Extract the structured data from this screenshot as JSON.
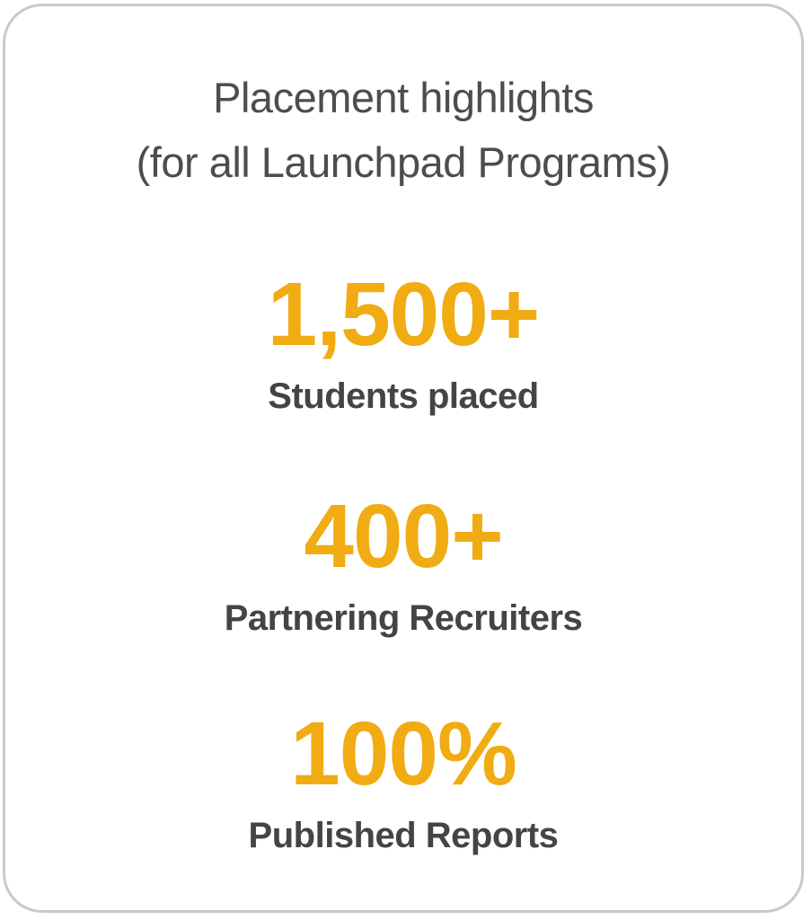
{
  "card": {
    "title_line_1": "Placement highlights",
    "title_line_2": "(for all Launchpad Programs)"
  },
  "stats": [
    {
      "value": "1,500+",
      "label": "Students placed"
    },
    {
      "value": "400+",
      "label": "Partnering Recruiters"
    },
    {
      "value": "100%",
      "label": "Published Reports"
    }
  ],
  "colors": {
    "accent": "#f0ac12",
    "title_text": "#4d4d4d",
    "label_text": "#444444",
    "border": "#c9c9c9"
  }
}
